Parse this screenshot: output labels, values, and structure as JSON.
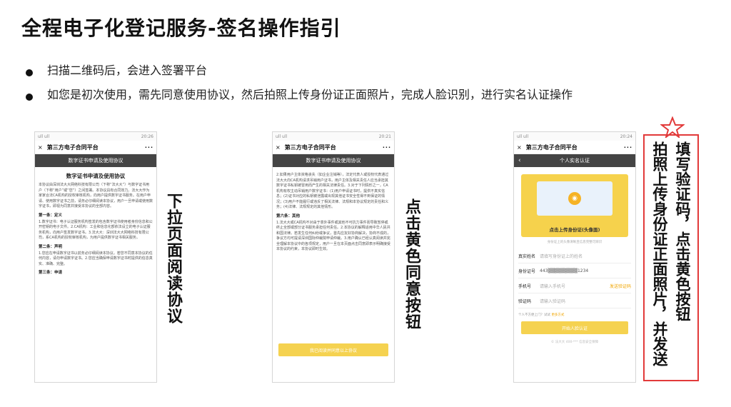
{
  "title": "全程电子化登记服务-签名操作指引",
  "bullets": [
    "扫描二维码后，会进入签署平台",
    "如您是初次使用，需先同意使用协议，然后拍照上传身份证正面照片，完成人脸识别，进行实名认证操作"
  ],
  "phone1": {
    "status_left": "ull ull",
    "status_right": "20:26",
    "app_title": "第三方电子合同平台",
    "more": "···",
    "close": "×",
    "bar_title": "数字证书申请及使用协议",
    "doc_heading": "数字证书申请及使用协议",
    "doc_para1": "本协议由深圳法大大网络科技有限公司（下称“法大大”）与数字证书用户（下称“用户”或“您”）之间签署。本协议具有合同效力。法大大作为家家合法CA机构的授权审核机构，向用户提供数字证书服务。在用户申请、使用数字证书之前，请务必仔细阅读本协议，用户一旦申请或使用数字证书，即视为同意并接受本协议的全部内容。",
    "section1": "第一条：定义",
    "doc_para2": "1.数字证书：电子认证服务机构签发的包含数字证书使用者身份信息和公开密钥的电子文件。2.CA机构：工业和信息化部依法设立的电子认证服务机构，向用户签发数字证书。3.法大大：深圳法大大网络科技有限公司，系CA机构的授权审核机构，为用户提供数字证书相关服务。",
    "section2": "第二条：声明",
    "doc_para3": "1.您应在申请数字证书以前务必仔细阅读本协议。若您不同意本协议的任何内容，请勿申请数字证书。2.您应当确保申请数字证书时提供的信息真实、准确、完整。",
    "section3": "第三条：申请"
  },
  "phone2": {
    "status_left": "ull ull",
    "status_right": "20:21",
    "app_title": "第三方电子合同平台",
    "more": "···",
    "close": "×",
    "bar_title": "数字证书申请及使用协议",
    "doc_para1": "2.如果用户主体资格丧失（如企业注销等），法定代表人或授权代表通过法大大向CA机构请求吊销用户证书，用户主体及相关责任人应当承担其数字证书私钥被冒用而产生的相关法律责任。3.对于下列情形之一，CA机构有权主动吊销用户数字证书：(1)用户申请证书时，提供不真实信息；(2)证书对应的私钥被泄露或出现其他证书安全性得不到保证的情况；(3)用户不能履行或违反了相关法律、法规和本协议规定的责任和义务；(4)法律、法规规定的其他情形。",
    "section": "第六条：其他",
    "doc_para2": "1.法大大或CA机构不对由于意外事件或其他不可抗力事件而导致暂停或终止全部或部分证书服务承担任何责任。2.本协议的解释适用中华人民共和国法律。若发生任何纠纷或争议，首先应友好协商解决，协商不成的，争议方均可提请深圳国际仲裁院申请仲裁。3.用户确认已经认真阅读并完全理解本协议中的各项规定，用户一旦在本页面点击同意即表示明确接受本协议的约束，本协议即时生效。",
    "agree_button": "我已阅读并同意以上协议"
  },
  "phone3": {
    "status_left": "ull ull",
    "status_right": "20:24",
    "app_title": "第三方电子合同平台",
    "more": "···",
    "close": "×",
    "bar_title": "个人实名认证",
    "back": "‹",
    "upload_label": "点击上传身份证(头像面)",
    "upload_tip": "身份证上的头像清晰且信息完整可辨识",
    "rows": [
      {
        "key": "真实姓名",
        "value": "请填写身份证上的姓名",
        "link": ""
      },
      {
        "key": "身份证号",
        "value": "443▒▒▒▒▒▒▒▒▒1234",
        "link": ""
      },
      {
        "key": "手机号",
        "value": "请输入手机号",
        "link": "发送验证码"
      },
      {
        "key": "验证码",
        "value": "请输入验证码",
        "link": ""
      }
    ],
    "note_text": "个人不方便上门？试试",
    "note_link": "更多方式",
    "start_button": "开始人脸认证",
    "footer": "© 法大大 400-*** 信息安全保障"
  },
  "labels": {
    "label1": "下拉页面阅读协议",
    "label2": "点击黄色同意按钮",
    "label3_col1": "填写验证码，点击黄色按钮",
    "label3_col2": "拍照上传身份证正面照片，并发送"
  },
  "colors": {
    "accent_yellow": "#f5d250",
    "red_box": "#e23a3a"
  }
}
